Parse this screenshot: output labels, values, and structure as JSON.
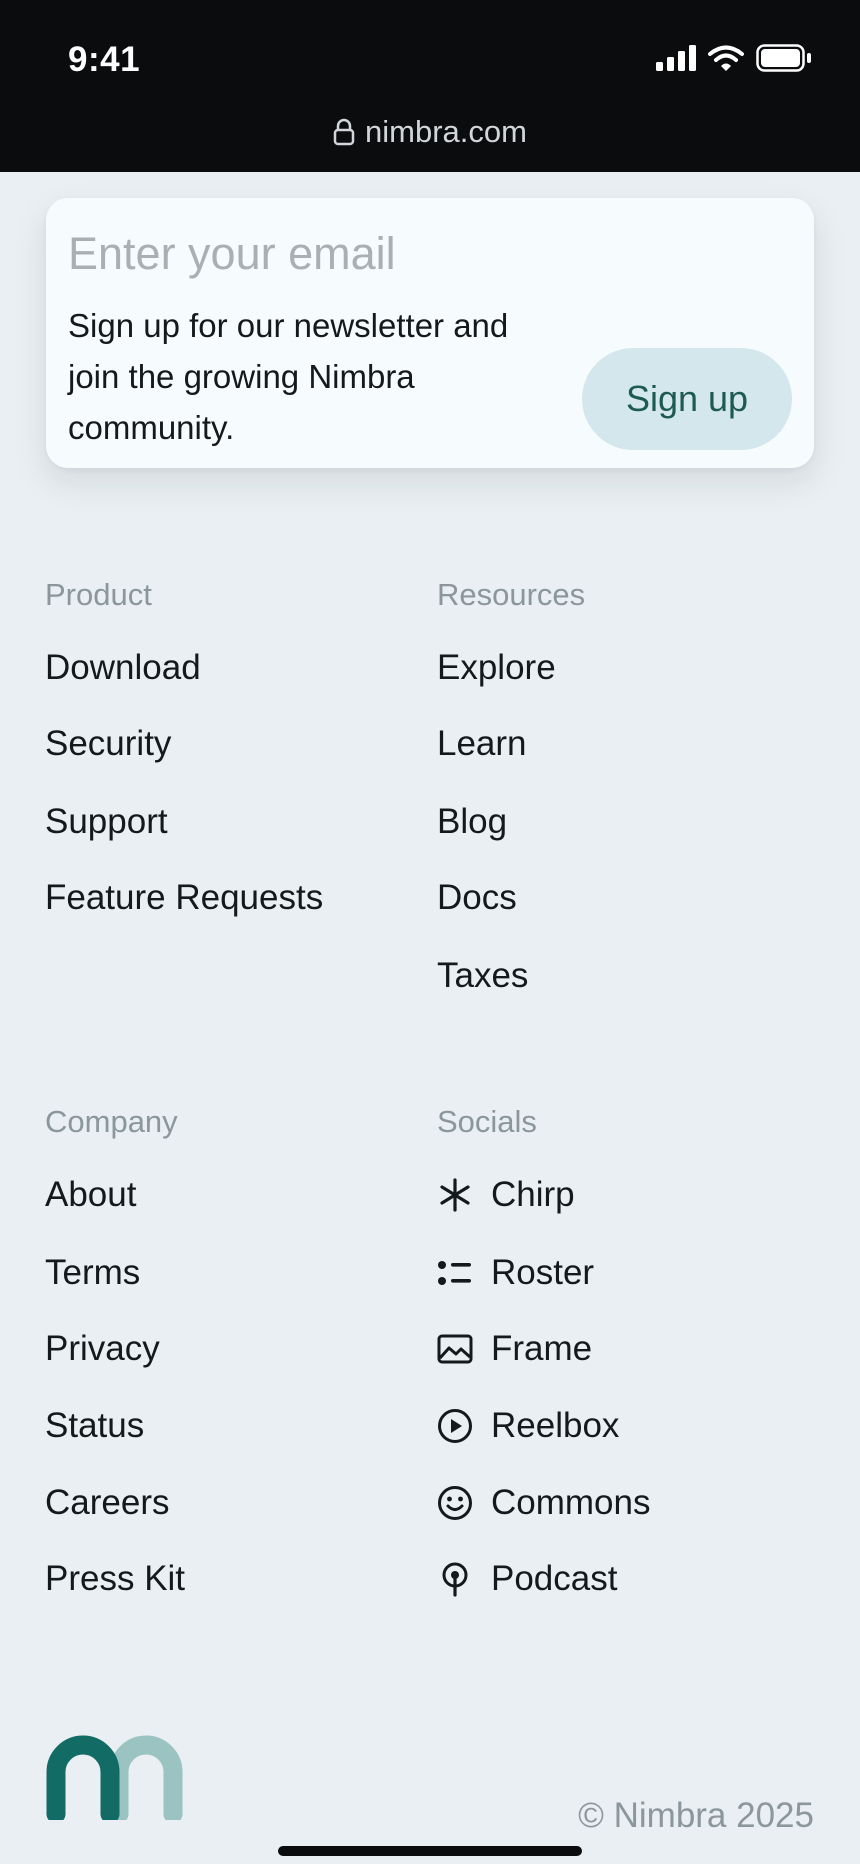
{
  "status_bar": {
    "time": "9:41",
    "url": "nimbra.com"
  },
  "newsletter": {
    "email_placeholder": "Enter your email",
    "email_value": "",
    "description": "Sign up for our newsletter and join the growing Nimbra community.",
    "signup_label": "Sign up"
  },
  "footer": {
    "product": {
      "title": "Product",
      "items": [
        "Download",
        "Security",
        "Support",
        "Feature Requests"
      ]
    },
    "resources": {
      "title": "Resources",
      "items": [
        "Explore",
        "Learn",
        "Blog",
        "Docs",
        "Taxes"
      ]
    },
    "company": {
      "title": "Company",
      "items": [
        "About",
        "Terms",
        "Privacy",
        "Status",
        "Careers",
        "Press Kit"
      ]
    },
    "socials": {
      "title": "Socials",
      "items": [
        {
          "label": "Chirp",
          "icon": "asterisk-icon"
        },
        {
          "label": "Roster",
          "icon": "list-icon"
        },
        {
          "label": "Frame",
          "icon": "image-icon"
        },
        {
          "label": "Reelbox",
          "icon": "play-circle-icon"
        },
        {
          "label": "Commons",
          "icon": "smiley-icon"
        },
        {
          "label": "Podcast",
          "icon": "podcast-icon"
        }
      ]
    },
    "copyright": "© Nimbra 2025"
  },
  "colors": {
    "accent": "#1d5a52",
    "logo_dark": "#126b64",
    "logo_light": "#9ac3c1",
    "button_bg": "#d3e7ec"
  }
}
